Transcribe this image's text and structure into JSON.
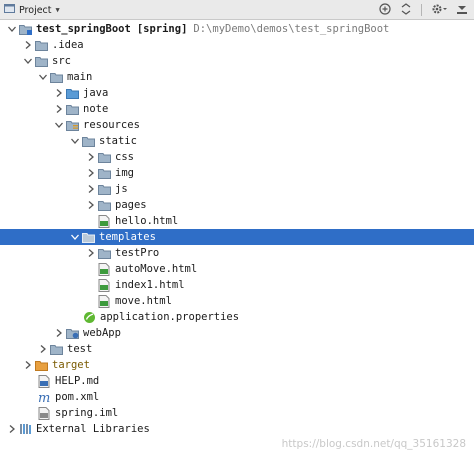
{
  "toolbar": {
    "title": "Project",
    "icons": [
      "project-view-icon",
      "caret-down-icon",
      "sync-icon",
      "divider-icon",
      "collapse-icon",
      "settings-icon",
      "hide-icon"
    ]
  },
  "tree": {
    "root": {
      "label": "test_springBoot",
      "module": "[spring]",
      "path": "D:\\myDemo\\demos\\test_springBoot"
    },
    "idea": ".idea",
    "src": "src",
    "main": "main",
    "java": "java",
    "note": "note",
    "resources": "resources",
    "static": "static",
    "css": "css",
    "img": "img",
    "js": "js",
    "pages": "pages",
    "hello": "hello.html",
    "templates": "templates",
    "testPro": "testPro",
    "autoMove": "autoMove.html",
    "index1": "index1.html",
    "move": "move.html",
    "appProps": "application.properties",
    "webApp": "webApp",
    "test": "test",
    "target": "target",
    "help": "HELP.md",
    "pom": "pom.xml",
    "iml": "spring.iml",
    "extLibs": "External Libraries"
  },
  "colors": {
    "selection": "#2f6ec7",
    "folder": "#8ba0b5",
    "folder_blue": "#5a9bd6",
    "folder_orange": "#e8a040",
    "html_green": "#3d9b3d",
    "maven_blue": "#3a6fb5"
  },
  "watermark": "https://blog.csdn.net/qq_35161328"
}
